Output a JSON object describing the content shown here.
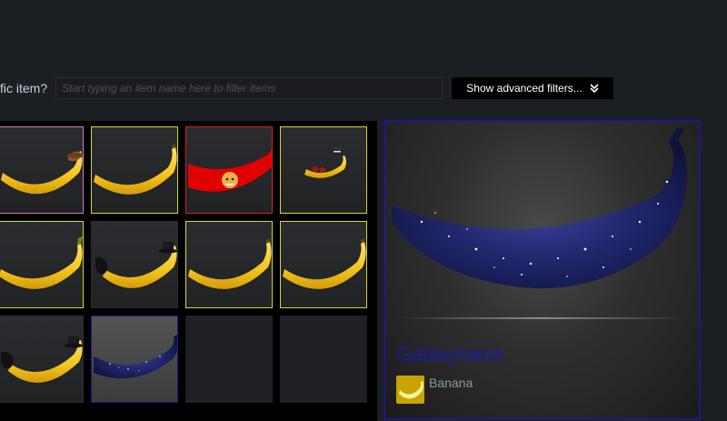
{
  "filter": {
    "label": "fic item?",
    "placeholder": "Start typing an item name here to filter items",
    "value": "",
    "advanced_button": "Show advanced filters..."
  },
  "colors": {
    "page_bg": "#1b1e23",
    "rarity_pink": "#d47cb8",
    "rarity_yellow": "#d8d43a",
    "rarity_red": "#d61f1f",
    "rarity_blue": "#1a1a8c",
    "banana_yellow": "#f2c41b",
    "galaxy_dark": "#141a4d"
  },
  "inventory": {
    "items": [
      {
        "slot": 1,
        "image": "banana-cowboy-hat",
        "border": "pink"
      },
      {
        "slot": 2,
        "image": "banana-plain",
        "border": "yellow"
      },
      {
        "slot": 3,
        "image": "banana-red-shiba",
        "border": "red"
      },
      {
        "slot": 4,
        "image": "banana-tiny-fedora-sticker",
        "border": "yellow"
      },
      {
        "slot": 5,
        "image": "banana-green-stem",
        "border": "yellow"
      },
      {
        "slot": 6,
        "image": "banana-top-hat-glove",
        "border": "none"
      },
      {
        "slot": 7,
        "image": "banana-plain",
        "border": "yellow"
      },
      {
        "slot": 8,
        "image": "banana-plain",
        "border": "yellow"
      },
      {
        "slot": 9,
        "image": "banana-top-hat-glove",
        "border": "none"
      },
      {
        "slot": 10,
        "image": "galaxy-banana",
        "border": "blue",
        "selected": true
      },
      {
        "slot": 11,
        "image": "empty"
      },
      {
        "slot": 12,
        "image": "empty"
      }
    ]
  },
  "detail": {
    "item_name": "Galaxynana",
    "game_name": "Banana",
    "game_icon": "banana-app-icon"
  }
}
